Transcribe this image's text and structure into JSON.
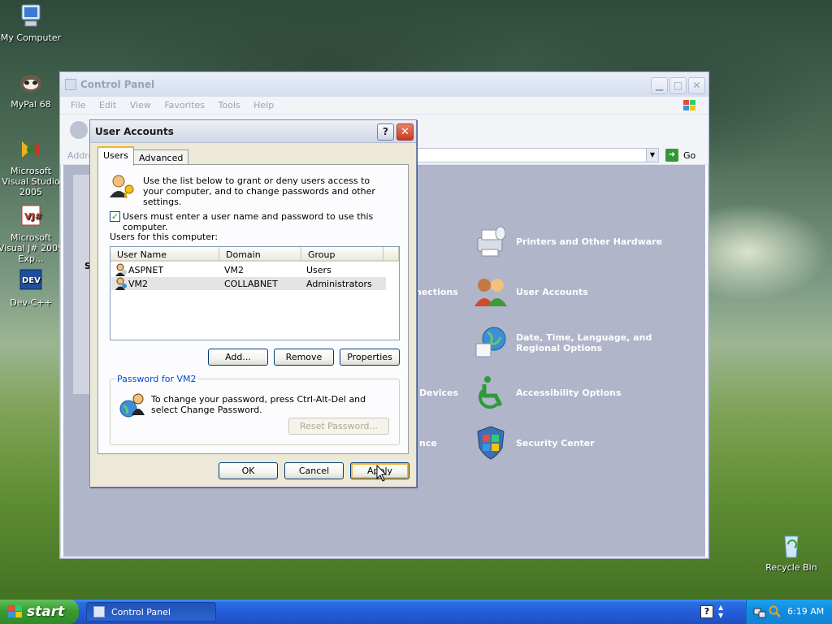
{
  "desktop": {
    "icons": [
      {
        "label": "My Computer"
      },
      {
        "label": "MyPal 68"
      },
      {
        "label": "Microsoft Visual Studio 2005"
      },
      {
        "label": "Microsoft Visual J# 2005 Exp..."
      },
      {
        "label": "Dev-C++"
      },
      {
        "label": "Recycle Bin"
      }
    ]
  },
  "control_panel": {
    "title": "Control Panel",
    "menu": [
      "File",
      "Edit",
      "View",
      "Favorites",
      "Tools",
      "Help"
    ],
    "address_label": "Addre",
    "go_label": "Go",
    "left_pane_fragment": "S",
    "categories": [
      {
        "label": "Printers and Other Hardware"
      },
      {
        "label": "User Accounts"
      },
      {
        "label": "Date, Time, Language, and Regional Options"
      },
      {
        "label": "Accessibility Options"
      },
      {
        "label": "Security Center"
      }
    ],
    "partial_labels": {
      "connections": "nections",
      "devices": "Devices",
      "maintenance": "nce"
    }
  },
  "dialog": {
    "title": "User Accounts",
    "tabs": [
      "Users",
      "Advanced"
    ],
    "intro": "Use the list below to grant or deny users access to your computer, and to change passwords and other settings.",
    "require_login_label": "Users must enter a user name and password to use this computer.",
    "require_login_checked": true,
    "list_caption": "Users for this computer:",
    "columns": [
      "User Name",
      "Domain",
      "Group"
    ],
    "users": [
      {
        "name": "ASPNET",
        "domain": "VM2",
        "group": "Users"
      },
      {
        "name": "VM2",
        "domain": "COLLABNET",
        "group": "Administrators"
      }
    ],
    "buttons": {
      "add": "Add...",
      "remove": "Remove",
      "properties": "Properties"
    },
    "password_group_title": "Password for VM2",
    "password_text": "To change your password, press Ctrl-Alt-Del and select Change Password.",
    "reset_password": "Reset Password...",
    "footer": {
      "ok": "OK",
      "cancel": "Cancel",
      "apply": "Apply"
    }
  },
  "taskbar": {
    "start_label": "start",
    "task_item": "Control Panel",
    "clock": "6:19 AM"
  }
}
